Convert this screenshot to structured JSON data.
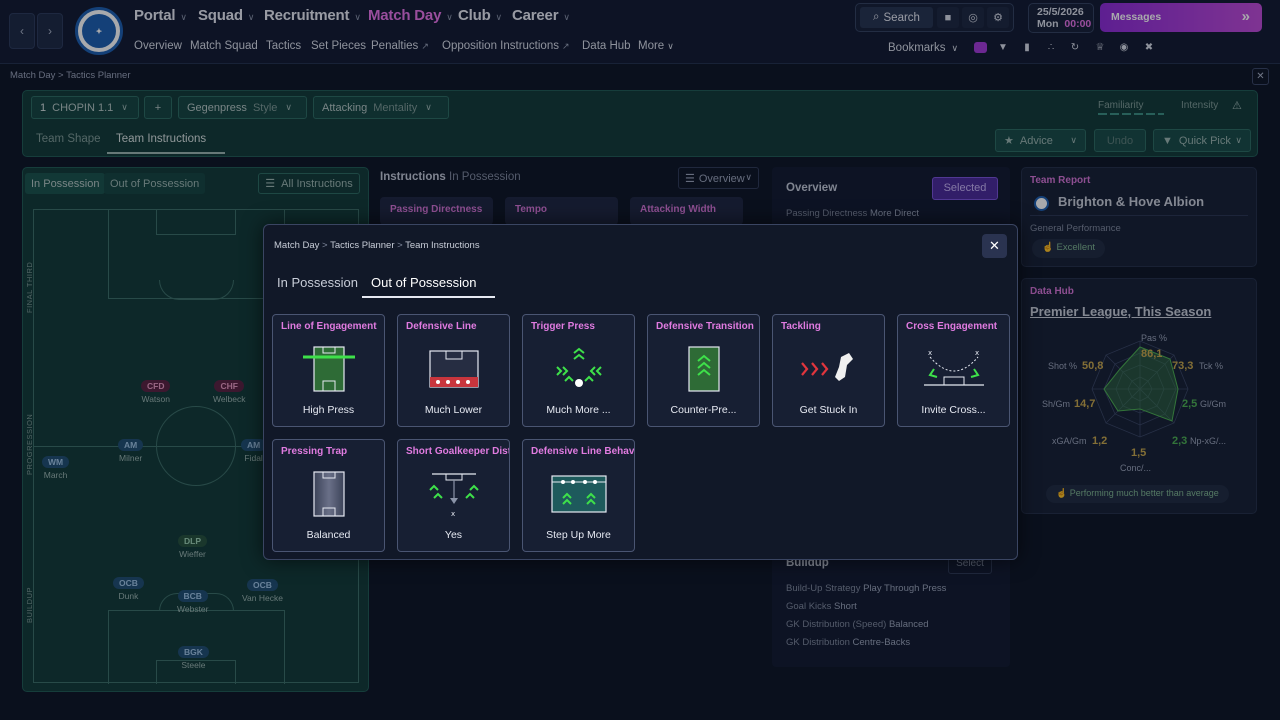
{
  "header": {
    "menus": [
      {
        "label": "Portal",
        "active": false
      },
      {
        "label": "Squad",
        "active": false
      },
      {
        "label": "Recruitment",
        "active": false
      },
      {
        "label": "Match Day",
        "active": true
      },
      {
        "label": "Club",
        "active": false
      },
      {
        "label": "Career",
        "active": false
      }
    ],
    "subnav": [
      "Overview",
      "Match Squad",
      "Tactics",
      "Set Pieces",
      "Penalties",
      "Opposition Instructions",
      "Data Hub",
      "More"
    ],
    "search_label": "Search",
    "date": "25/5/2026",
    "day": "Mon",
    "time": "00:00",
    "messages_label": "Messages",
    "bookmarks_label": "Bookmarks"
  },
  "breadcrumb": {
    "items": [
      "Match Day",
      "Tactics Planner"
    ]
  },
  "tactic_bar": {
    "formation_num": "1",
    "formation": "CHOPIN 1.1",
    "style_value": "Gegenpress",
    "style_label": "Style",
    "mentality_value": "Attacking",
    "mentality_label": "Mentality",
    "familiarity_label": "Familiarity",
    "intensity_label": "Intensity",
    "tabs": [
      "Team Shape",
      "Team Instructions"
    ],
    "advice_label": "Advice",
    "undo_label": "Undo",
    "quick_pick_label": "Quick Pick"
  },
  "pitch": {
    "tabs": [
      "In Possession",
      "Out of Possession"
    ],
    "all_instructions_label": "All Instructions",
    "zones": [
      "FINAL THIRD",
      "PROGRESSION",
      "BUILDUP"
    ],
    "players": [
      {
        "role": "CFD",
        "name": "Watson",
        "kind": "r"
      },
      {
        "role": "CHF",
        "name": "Welbeck",
        "kind": "r"
      },
      {
        "role": "AM",
        "name": "Milner",
        "kind": "b"
      },
      {
        "role": "AM",
        "name": "Fidal",
        "kind": "b"
      },
      {
        "role": "WM",
        "name": "March",
        "kind": "b"
      },
      {
        "role": "DLP",
        "name": "Wieffer",
        "kind": "g"
      },
      {
        "role": "OCB",
        "name": "Dunk",
        "kind": "b"
      },
      {
        "role": "BCB",
        "name": "Webster",
        "kind": "b"
      },
      {
        "role": "OCB",
        "name": "Van Hecke",
        "kind": "b"
      },
      {
        "role": "BGK",
        "name": "Steele",
        "kind": "b"
      }
    ]
  },
  "instructions": {
    "title": "Instructions",
    "subtitle": "In Possession",
    "view_select": "Overview",
    "tabs": [
      "Passing Directness",
      "Tempo",
      "Attacking Width"
    ]
  },
  "overview": {
    "title": "Overview",
    "selected_label": "Selected",
    "passing_directness_label": "Passing Directness",
    "passing_directness_value": "More Direct",
    "buildup_title": "Buildup",
    "select_label": "Select",
    "rows": [
      {
        "label": "Build-Up Strategy",
        "value": "Play Through Press"
      },
      {
        "label": "Goal Kicks",
        "value": "Short"
      },
      {
        "label": "GK Distribution (Speed)",
        "value": "Balanced"
      },
      {
        "label": "GK Distribution",
        "value": "Centre-Backs"
      }
    ]
  },
  "team_report": {
    "title": "Team Report",
    "team": "Brighton & Hove Albion",
    "performance_label": "General Performance",
    "performance_value": "Excellent"
  },
  "data_hub": {
    "title": "Data Hub",
    "competition": "Premier League, This Season",
    "stats": [
      {
        "label": "Pas %",
        "value": "86,1"
      },
      {
        "label": "Tck %",
        "value": "73,3"
      },
      {
        "label": "Gl/Gm",
        "value": "2,5"
      },
      {
        "label": "Np-xG/...",
        "value": "2,3"
      },
      {
        "label": "Conc/...",
        "value": "1,5"
      },
      {
        "label": "xGA/Gm",
        "value": "1,2"
      },
      {
        "label": "Sh/Gm",
        "value": "14,7"
      },
      {
        "label": "Shot %",
        "value": "50,8"
      }
    ],
    "footer": "Performing much better than average"
  },
  "modal": {
    "breadcrumb": [
      "Match Day",
      "Tactics Planner",
      "Team Instructions"
    ],
    "tabs": [
      "In Possession",
      "Out of Possession"
    ],
    "cards": [
      {
        "title": "Line of Engagement",
        "value": "High Press",
        "icon": "line-of-engagement-icon"
      },
      {
        "title": "Defensive Line",
        "value": "Much Lower",
        "icon": "defensive-line-icon"
      },
      {
        "title": "Trigger Press",
        "value": "Much More ...",
        "icon": "trigger-press-icon"
      },
      {
        "title": "Defensive Transition",
        "value": "Counter-Pre...",
        "icon": "defensive-transition-icon"
      },
      {
        "title": "Tackling",
        "value": "Get Stuck In",
        "icon": "tackling-icon"
      },
      {
        "title": "Cross Engagement",
        "value": "Invite Cross...",
        "icon": "cross-engagement-icon"
      },
      {
        "title": "Pressing Trap",
        "value": "Balanced",
        "icon": "pressing-trap-icon"
      },
      {
        "title": "Short Goalkeeper Distr",
        "value": "Yes",
        "icon": "short-goalkeeper-distribution-icon"
      },
      {
        "title": "Defensive Line Behavic",
        "value": "Step Up More",
        "icon": "defensive-line-behaviour-icon"
      }
    ]
  },
  "colors": {
    "accent": "#e873e8",
    "teal_panel": "#123a36",
    "messages": "#a33ad8"
  }
}
